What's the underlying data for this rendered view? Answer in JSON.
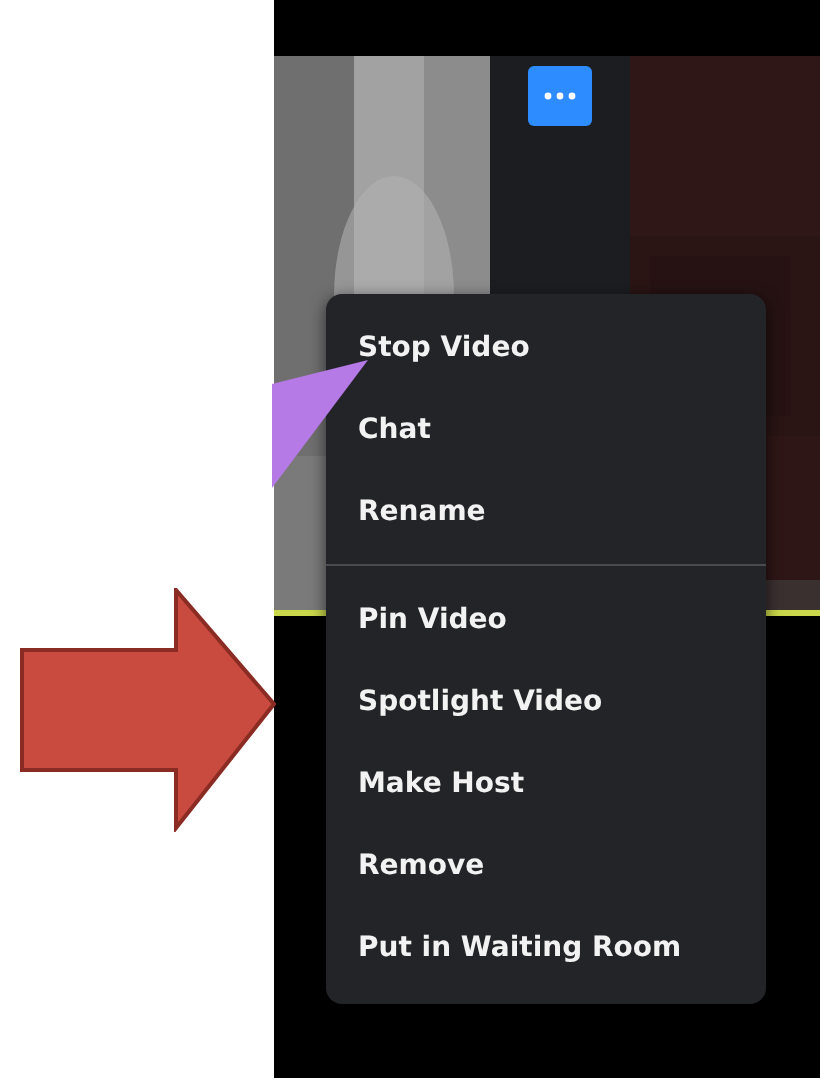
{
  "more_button": {
    "selected": true
  },
  "context_menu": {
    "groups": [
      [
        "Stop Video",
        "Chat",
        "Rename"
      ],
      [
        "Pin Video",
        "Spotlight Video",
        "Make Host",
        "Remove",
        "Put in Waiting Room"
      ]
    ]
  }
}
